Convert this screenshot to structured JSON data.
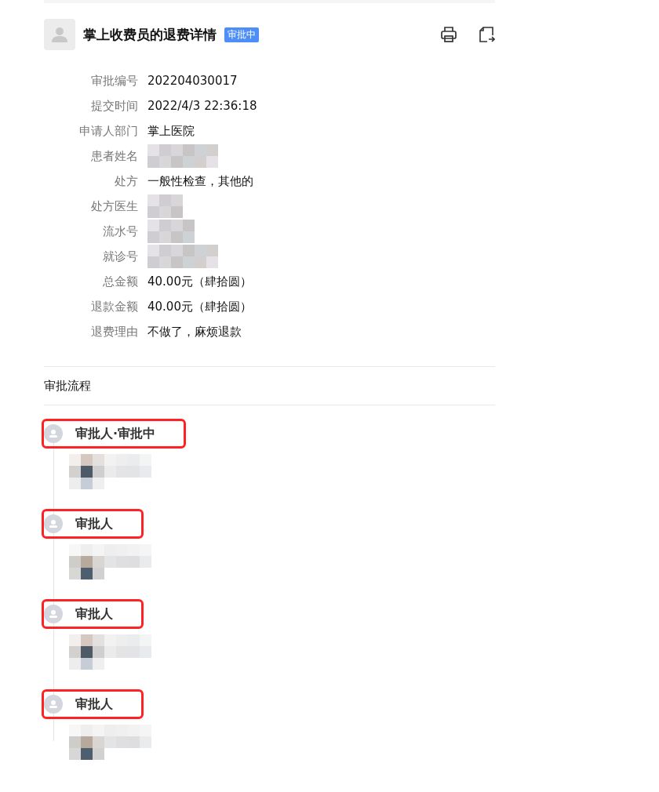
{
  "header": {
    "title": "掌上收费员的退费详情",
    "status": "审批中"
  },
  "fields": [
    {
      "label": "审批编号",
      "value": "202204030017"
    },
    {
      "label": "提交时间",
      "value": "2022/4/3 22:36:18"
    },
    {
      "label": "申请人部门",
      "value": "掌上医院"
    },
    {
      "label": "患者姓名",
      "redacted": true
    },
    {
      "label": "处方",
      "value": "一般性检查，其他的"
    },
    {
      "label": "处方医生",
      "redacted": true
    },
    {
      "label": "流水号",
      "redacted": true
    },
    {
      "label": "就诊号",
      "redacted": true
    },
    {
      "label": "总金额",
      "value": "40.00元（肆拾圆）"
    },
    {
      "label": "退款金额",
      "value": "40.00元（肆拾圆）"
    },
    {
      "label": "退费理由",
      "value": "不做了，麻烦退款"
    }
  ],
  "process": {
    "title": "审批流程",
    "steps": [
      {
        "title": "审批人·审批中",
        "highlighted": true
      },
      {
        "title": "审批人",
        "highlighted": true
      },
      {
        "title": "审批人",
        "highlighted": true
      },
      {
        "title": "审批人",
        "highlighted": true
      }
    ]
  }
}
